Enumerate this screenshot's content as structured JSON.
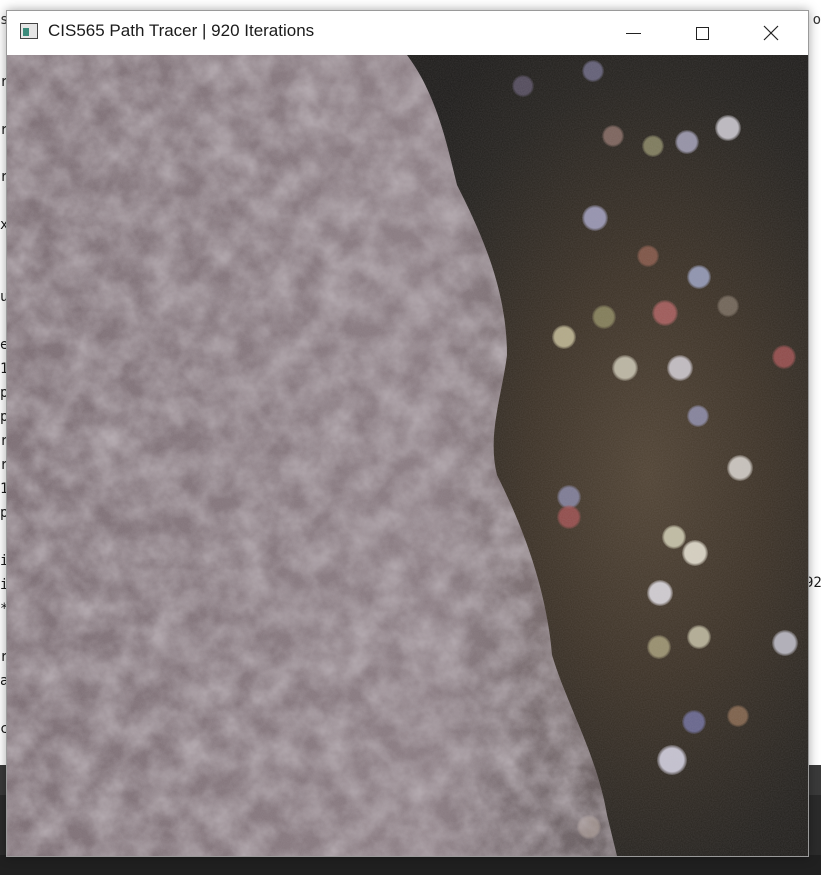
{
  "window": {
    "title": "CIS565 Path Tracer | 920 Iterations",
    "controls": {
      "minimize": "minimize",
      "maximize": "maximize",
      "close": "close"
    }
  },
  "background_console": {
    "left_chars": [
      "r",
      "r",
      "r",
      "x",
      "u",
      "e",
      "1",
      "p",
      "p",
      "r",
      "r",
      "1",
      "p",
      "i",
      "i",
      "*",
      "r",
      "a",
      "c"
    ],
    "top_left_char": "s",
    "top_right_text": "o",
    "right_text": "92"
  },
  "colors": {
    "titlebar_bg": "#ffffff",
    "fur": "#8a7b80",
    "background_bokeh": "#3a3024"
  },
  "icons": {
    "app": "app-window-icon",
    "minimize": "minimize-icon",
    "maximize": "maximize-icon",
    "close": "close-icon"
  }
}
